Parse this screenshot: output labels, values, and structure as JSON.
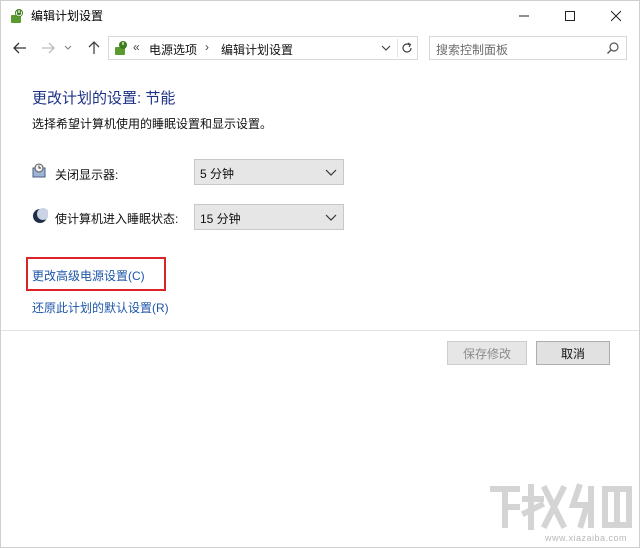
{
  "window": {
    "title": "编辑计划设置",
    "controls": {
      "minimize": "minimize",
      "maximize": "maximize",
      "close": "close"
    }
  },
  "nav": {
    "icons": [
      "back-arrow-icon",
      "forward-arrow-icon",
      "recent-chevron-icon",
      "up-arrow-icon"
    ]
  },
  "address": {
    "overflow": "«",
    "crumbs": [
      "电源选项",
      "编辑计划设置"
    ],
    "separator": "›"
  },
  "search": {
    "placeholder": "搜索控制面板"
  },
  "content": {
    "heading": "更改计划的设置: 节能",
    "subheading": "选择希望计算机使用的睡眠设置和显示设置。",
    "settings": [
      {
        "label": "关闭显示器:",
        "value": "5 分钟",
        "icon": "monitor-clock-icon"
      },
      {
        "label": "使计算机进入睡眠状态:",
        "value": "15 分钟",
        "icon": "moon-sleep-icon"
      }
    ],
    "links": {
      "advanced": "更改高级电源设置(C)",
      "restore": "还原此计划的默认设置(R)"
    },
    "highlight_color": "#d9252a"
  },
  "buttons": {
    "save": "保存修改",
    "cancel": "取消"
  },
  "watermark": {
    "text": "www.xiazaiba.com"
  },
  "colors": {
    "heading": "#1e3287",
    "link": "#1e56a8",
    "button_face": "#e1e1e1"
  }
}
